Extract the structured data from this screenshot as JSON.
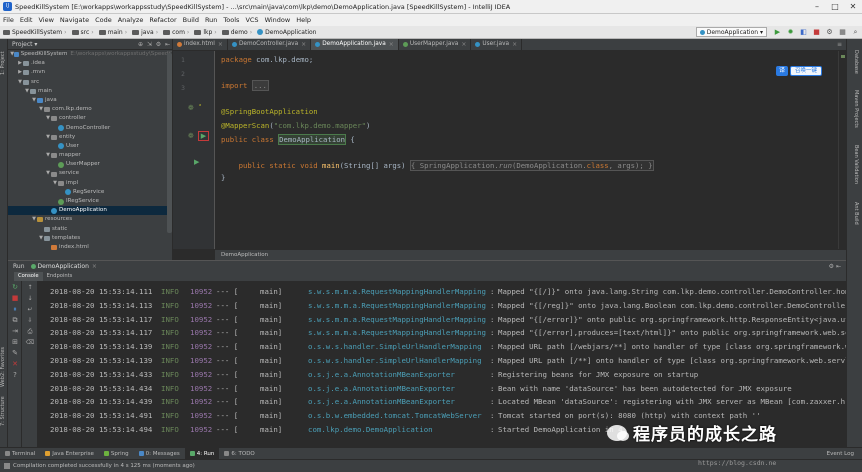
{
  "window": {
    "title": "SpeedKillSystem [E:\\workapps\\workappsstudy\\SpeedKillSystem] - ...\\src\\main\\java\\com\\lkp\\demo\\DemoApplication.java [SpeedKillSystem] - IntelliJ IDEA",
    "minimize": "–",
    "maximize": "□",
    "close": "✕"
  },
  "menu": [
    "File",
    "Edit",
    "View",
    "Navigate",
    "Code",
    "Analyze",
    "Refactor",
    "Build",
    "Run",
    "Tools",
    "VCS",
    "Window",
    "Help"
  ],
  "nav": {
    "crumbs": [
      "SpeedKillSystem",
      "src",
      "main",
      "java",
      "com",
      "lkp",
      "demo",
      "DemoApplication"
    ],
    "run_config": "DemoApplication ▾"
  },
  "left_stripe": [
    "1: Project",
    "2: Favorites",
    "7: Structure",
    "Web"
  ],
  "right_stripe": [
    "Database",
    "Maven Projects",
    "Bean Validation",
    "Ant Build"
  ],
  "project": {
    "header": "Project ▾",
    "tree": [
      {
        "label": "SpeedKillSystem",
        "path": "E:\\workapps\\workappsstudy\\SpeedK",
        "depth": 0,
        "arrow": "▼",
        "icon": "src",
        "selected": false
      },
      {
        "label": ".idea",
        "path": "",
        "depth": 1,
        "arrow": "▶",
        "icon": "folder",
        "selected": false
      },
      {
        "label": ".mvn",
        "path": "",
        "depth": 1,
        "arrow": "▶",
        "icon": "folder",
        "selected": false
      },
      {
        "label": "src",
        "path": "",
        "depth": 1,
        "arrow": "▼",
        "icon": "folder",
        "selected": false
      },
      {
        "label": "main",
        "path": "",
        "depth": 2,
        "arrow": "▼",
        "icon": "folder",
        "selected": false
      },
      {
        "label": "java",
        "path": "",
        "depth": 3,
        "arrow": "▼",
        "icon": "src",
        "selected": false
      },
      {
        "label": "com.lkp.demo",
        "path": "",
        "depth": 4,
        "arrow": "▼",
        "icon": "pkg",
        "selected": false
      },
      {
        "label": "controller",
        "path": "",
        "depth": 5,
        "arrow": "▼",
        "icon": "pkg",
        "selected": false
      },
      {
        "label": "DemoController",
        "path": "",
        "depth": 6,
        "arrow": "",
        "icon": "class",
        "selected": false
      },
      {
        "label": "entity",
        "path": "",
        "depth": 5,
        "arrow": "▼",
        "icon": "pkg",
        "selected": false
      },
      {
        "label": "User",
        "path": "",
        "depth": 6,
        "arrow": "",
        "icon": "class",
        "selected": false
      },
      {
        "label": "mapper",
        "path": "",
        "depth": 5,
        "arrow": "▼",
        "icon": "pkg",
        "selected": false
      },
      {
        "label": "UserMapper",
        "path": "",
        "depth": 6,
        "arrow": "",
        "icon": "iface",
        "selected": false
      },
      {
        "label": "service",
        "path": "",
        "depth": 5,
        "arrow": "▼",
        "icon": "pkg",
        "selected": false
      },
      {
        "label": "impl",
        "path": "",
        "depth": 6,
        "arrow": "▼",
        "icon": "pkg",
        "selected": false
      },
      {
        "label": "RegService",
        "path": "",
        "depth": 7,
        "arrow": "",
        "icon": "class",
        "selected": false
      },
      {
        "label": "IRegService",
        "path": "",
        "depth": 6,
        "arrow": "",
        "icon": "iface",
        "selected": false
      },
      {
        "label": "DemoApplication",
        "path": "",
        "depth": 5,
        "arrow": "",
        "icon": "class",
        "selected": true
      },
      {
        "label": "resources",
        "path": "",
        "depth": 3,
        "arrow": "▼",
        "icon": "res",
        "selected": false
      },
      {
        "label": "static",
        "path": "",
        "depth": 4,
        "arrow": "",
        "icon": "folder",
        "selected": false
      },
      {
        "label": "templates",
        "path": "",
        "depth": 4,
        "arrow": "▼",
        "icon": "folder",
        "selected": false
      },
      {
        "label": "index.html",
        "path": "",
        "depth": 5,
        "arrow": "",
        "icon": "html",
        "selected": false
      }
    ]
  },
  "editor_tabs": [
    {
      "label": "index.html",
      "color": "#d07a3a",
      "active": false
    },
    {
      "label": "DemoController.java",
      "color": "#3592c4",
      "active": false
    },
    {
      "label": "DemoApplication.java",
      "color": "#3592c4",
      "active": true
    },
    {
      "label": "UserMapper.java",
      "color": "#5d9c57",
      "active": false
    },
    {
      "label": "User.java",
      "color": "#3592c4",
      "active": false
    }
  ],
  "editor": {
    "line_numbers": [
      "1",
      "2",
      "3",
      "",
      "",
      "",
      "",
      "",
      "",
      "",
      "",
      ""
    ],
    "lines": {
      "pkg_kw": "package",
      "pkg_name": " com.lkp.demo;",
      "import_kw": "import",
      "import_fold": "...",
      "ann1": "@SpringBootApplication",
      "ann2": "@MapperScan",
      "ann2_arg_open": "(",
      "ann2_arg": "\"com.lkp.demo.mapper\"",
      "ann2_arg_close": ")",
      "cls_kw": "public class ",
      "cls_name": "DemoApplication",
      "cls_brace": " {",
      "main_kw": "    public static void ",
      "main_fn": "main",
      "main_args": "(String[] args) ",
      "main_body_open": "{ SpringApplication.",
      "main_run": "run",
      "main_body_rest": "(DemoApplication.",
      "main_class_kw": "class",
      "main_body_end": ", args); }",
      "close_brace": "}"
    },
    "breadcrumb": "DemoApplication"
  },
  "translate": {
    "icon": "译",
    "button": "召唤一键"
  },
  "run": {
    "title": "Run",
    "tab": "DemoApplication",
    "subtabs": [
      "Console",
      "Endpoints"
    ],
    "logs": [
      {
        "ts": "2018-08-20 15:53:14.111",
        "level": "INFO",
        "pid": "10952",
        "sep": "--- [",
        "thread": "main]",
        "logger": "s.w.s.m.m.a.RequestMappingHandlerMapping",
        "colon": ":",
        "msg": "Mapped \"{[/]}\" onto java.lang.String com.lkp.demo.controller.DemoController.hom"
      },
      {
        "ts": "2018-08-20 15:53:14.113",
        "level": "INFO",
        "pid": "10952",
        "sep": "--- [",
        "thread": "main]",
        "logger": "s.w.s.m.m.a.RequestMappingHandlerMapping",
        "colon": ":",
        "msg": "Mapped \"{[/reg]}\" onto java.lang.Boolean com.lkp.demo.controller.DemoController"
      },
      {
        "ts": "2018-08-20 15:53:14.117",
        "level": "INFO",
        "pid": "10952",
        "sep": "--- [",
        "thread": "main]",
        "logger": "s.w.s.m.m.a.RequestMappingHandlerMapping",
        "colon": ":",
        "msg": "Mapped \"{[/error]}\" onto public org.springframework.http.ResponseEntity<java.ut"
      },
      {
        "ts": "2018-08-20 15:53:14.117",
        "level": "INFO",
        "pid": "10952",
        "sep": "--- [",
        "thread": "main]",
        "logger": "s.w.s.m.m.a.RequestMappingHandlerMapping",
        "colon": ":",
        "msg": "Mapped \"{[/error],produces=[text/html]}\" onto public org.springframework.web.se"
      },
      {
        "ts": "2018-08-20 15:53:14.139",
        "level": "INFO",
        "pid": "10952",
        "sep": "--- [",
        "thread": "main]",
        "logger": "o.s.w.s.handler.SimpleUrlHandlerMapping",
        "colon": ":",
        "msg": "Mapped URL path [/webjars/**] onto handler of type [class org.springframework.we"
      },
      {
        "ts": "2018-08-20 15:53:14.139",
        "level": "INFO",
        "pid": "10952",
        "sep": "--- [",
        "thread": "main]",
        "logger": "o.s.w.s.handler.SimpleUrlHandlerMapping",
        "colon": ":",
        "msg": "Mapped URL path [/**] onto handler of type [class org.springframework.web.servl"
      },
      {
        "ts": "2018-08-20 15:53:14.433",
        "level": "INFO",
        "pid": "10952",
        "sep": "--- [",
        "thread": "main]",
        "logger": "o.s.j.e.a.AnnotationMBeanExporter",
        "colon": ":",
        "msg": "Registering beans for JMX exposure on startup"
      },
      {
        "ts": "2018-08-20 15:53:14.434",
        "level": "INFO",
        "pid": "10952",
        "sep": "--- [",
        "thread": "main]",
        "logger": "o.s.j.e.a.AnnotationMBeanExporter",
        "colon": ":",
        "msg": "Bean with name 'dataSource' has been autodetected for JMX exposure"
      },
      {
        "ts": "2018-08-20 15:53:14.439",
        "level": "INFO",
        "pid": "10952",
        "sep": "--- [",
        "thread": "main]",
        "logger": "o.s.j.e.a.AnnotationMBeanExporter",
        "colon": ":",
        "msg": "Located MBean 'dataSource': registering with JMX server as MBean [com.zaxxer.h"
      },
      {
        "ts": "2018-08-20 15:53:14.491",
        "level": "INFO",
        "pid": "10952",
        "sep": "--- [",
        "thread": "main]",
        "logger": "o.s.b.w.embedded.tomcat.TomcatWebServer",
        "colon": ":",
        "msg": "Tomcat started on port(s): 8080 (http) with context path ''"
      },
      {
        "ts": "2018-08-20 15:53:14.494",
        "level": "INFO",
        "pid": "10952",
        "sep": "--- [",
        "thread": "main]",
        "logger": "com.lkp.demo.DemoApplication",
        "colon": ":",
        "msg": "Started DemoApplication in 4."
      }
    ]
  },
  "toolwindows": [
    {
      "label": "Terminal",
      "color": "#888888",
      "active": false
    },
    {
      "label": "Java Enterprise",
      "color": "#e0a030",
      "active": false
    },
    {
      "label": "Spring",
      "color": "#6db33f",
      "active": false
    },
    {
      "label": "0: Messages",
      "color": "#4a88c7",
      "active": false
    },
    {
      "label": "4: Run",
      "color": "#59a869",
      "active": true
    },
    {
      "label": "6: TODO",
      "color": "#888888",
      "active": false
    }
  ],
  "event_log": "Event Log",
  "status": "Compilation completed successfully in 4 s 125 ms (moments ago)",
  "watermark": "程序员的成长之路",
  "url_watermark": "https://blog.csdn.ne"
}
